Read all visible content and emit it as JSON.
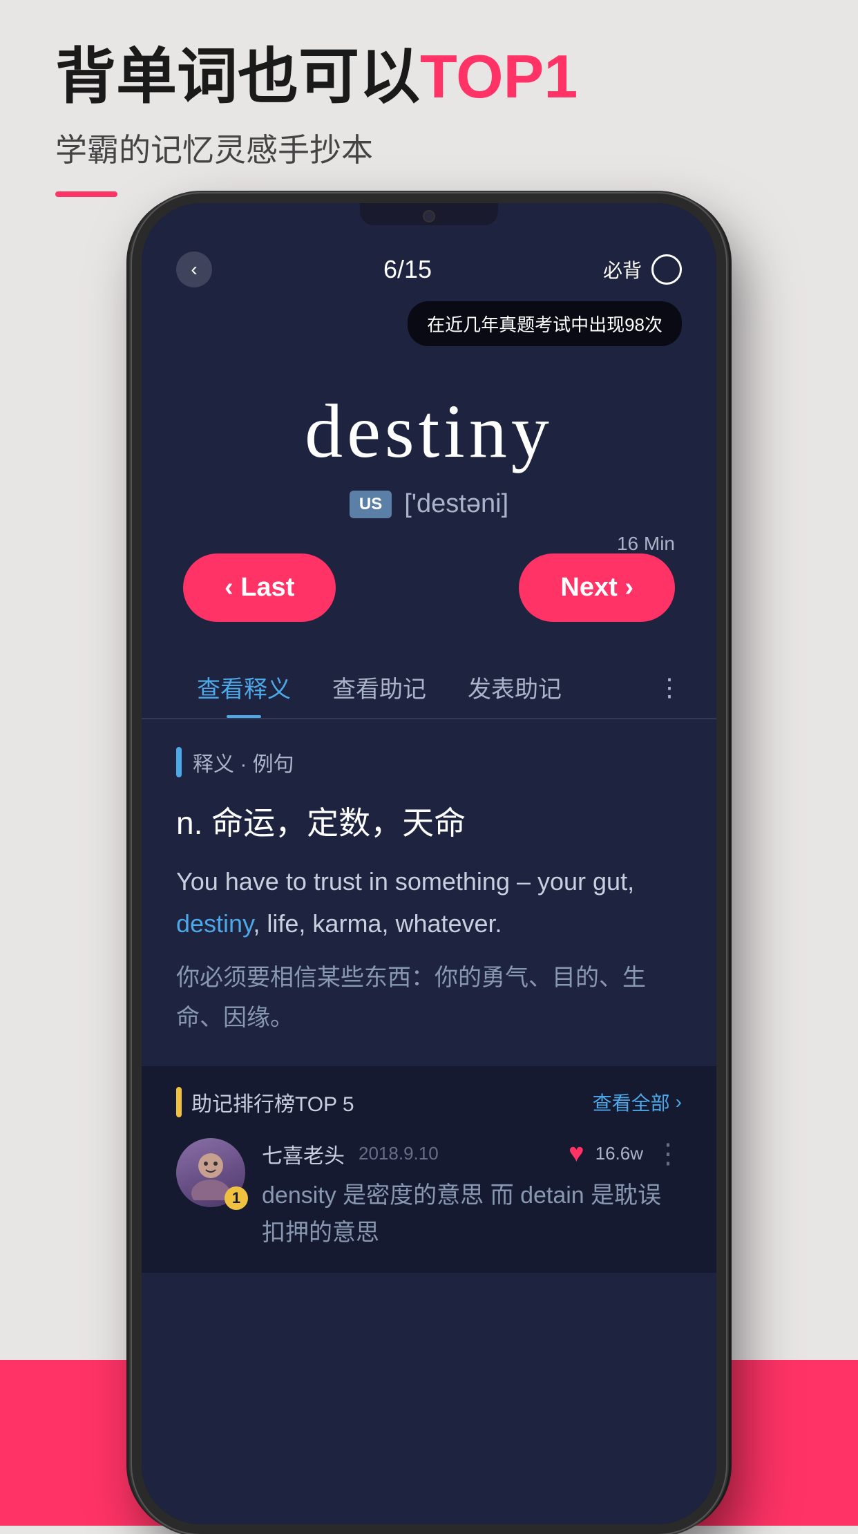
{
  "marketing": {
    "headline_part1": "背单词也可以",
    "headline_highlight": "TOP1",
    "subheadline": "学霸的记忆灵感手抄本"
  },
  "phone": {
    "header": {
      "back_icon": "‹",
      "progress": "6/15",
      "must_memorize_label": "必背"
    },
    "tooltip": "在近几年真题考试中出现98次",
    "word": {
      "text": "destiny",
      "pronunciation_badge": "US",
      "phonetic": "['destəni]"
    },
    "time_label": "16 Min",
    "buttons": {
      "last": "‹ Last",
      "next": "Next ›"
    },
    "tabs": [
      {
        "label": "查看释义",
        "active": true
      },
      {
        "label": "查看助记",
        "active": false
      },
      {
        "label": "发表助记",
        "active": false
      }
    ],
    "tab_more": "⋮",
    "definition": {
      "section_label": "释义 · 例句",
      "pos_and_meaning": "n.  命运，定数，天命",
      "example_en_parts": [
        {
          "text": "You have to trust in something – your gut, ",
          "highlight": false
        },
        {
          "text": "destiny",
          "highlight": true
        },
        {
          "text": ", life, karma, whatever.",
          "highlight": false
        }
      ],
      "example_zh": "你必须要相信某些东西：你的勇气、目的、生命、因缘。"
    },
    "mnemonics": {
      "section_label": "助记排行榜TOP 5",
      "view_all_label": "查看全部",
      "items": [
        {
          "rank": "1",
          "username": "七喜老头",
          "date": "2018.9.10",
          "like_count": "16.6w",
          "text": "density 是密度的意思  而 detain 是耽误扣押的意思"
        }
      ]
    }
  }
}
